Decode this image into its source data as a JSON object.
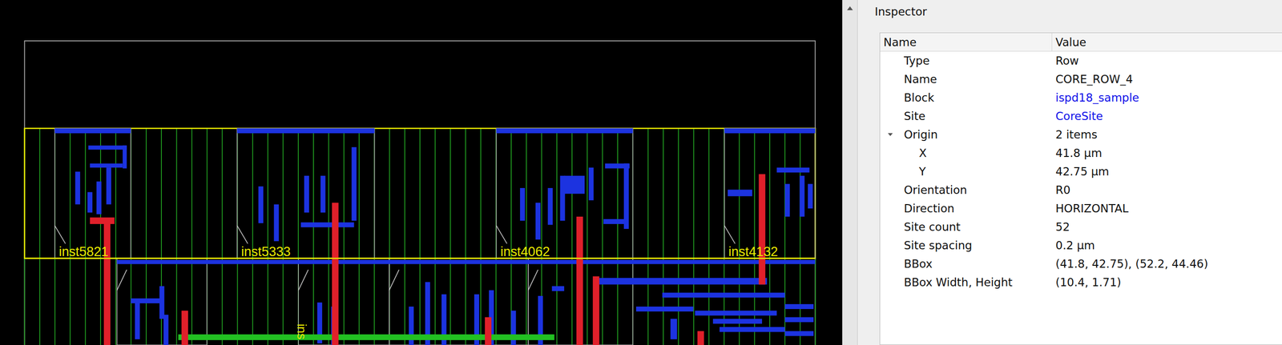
{
  "canvas": {
    "instances": [
      {
        "label": "inst5821"
      },
      {
        "label": "inst5333"
      },
      {
        "label": "inst4062"
      },
      {
        "label": "inst4132"
      }
    ],
    "lower_row_labels": [
      {
        "label": "ins"
      }
    ]
  },
  "inspector": {
    "title": "Inspector",
    "columns": [
      "Name",
      "Value"
    ],
    "rows": [
      {
        "name": "Type",
        "value": "Row",
        "kind": "text"
      },
      {
        "name": "Name",
        "value": "CORE_ROW_4",
        "kind": "text"
      },
      {
        "name": "Block",
        "value": "ispd18_sample",
        "kind": "link"
      },
      {
        "name": "Site",
        "value": "CoreSite",
        "kind": "link"
      },
      {
        "name": "Origin",
        "value": "2 items",
        "kind": "group",
        "expanded": true,
        "children": [
          {
            "name": "X",
            "value": "41.8 μm",
            "kind": "text"
          },
          {
            "name": "Y",
            "value": "42.75 μm",
            "kind": "text"
          }
        ]
      },
      {
        "name": "Orientation",
        "value": "R0",
        "kind": "text"
      },
      {
        "name": "Direction",
        "value": "HORIZONTAL",
        "kind": "text"
      },
      {
        "name": "Site count",
        "value": "52",
        "kind": "text"
      },
      {
        "name": "Site spacing",
        "value": "0.2 μm",
        "kind": "text"
      },
      {
        "name": "BBox",
        "value": "(41.8, 42.75), (52.2, 44.46)",
        "kind": "text"
      },
      {
        "name": "BBox Width, Height",
        "value": "(10.4, 1.71)",
        "kind": "text"
      }
    ]
  }
}
